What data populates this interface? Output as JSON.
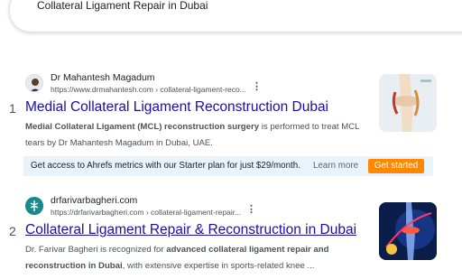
{
  "search": {
    "query": "Collateral Ligament Repair in Dubai"
  },
  "results": [
    {
      "rank": "1",
      "site_name": "Dr Mahantesh Magadum",
      "url": "https://www.drmahantesh.com › collateral-ligament-reco...",
      "title": "Medial Collateral Ligament Reconstruction Dubai",
      "snippet_bold_1": "Medial Collateral Ligament (MCL) reconstruction surgery",
      "snippet_text_1": " is performed to treat MCL tears by Dr Mahantesh Magadum in Dubai, UAE.",
      "favicon_icon": "doctor-portrait-icon",
      "thumb_icon": "knee-ligament-illustration"
    },
    {
      "rank": "2",
      "site_name": "drfarivarbagheri.com",
      "url": "https://drfarivarbagheri.com › collateral-ligament-repair...",
      "title": "Collateral Ligament Repair & Reconstruction in Dubai",
      "snippet_text_0": "Dr. Farivar Bagheri is recognized for ",
      "snippet_bold_1": "advanced collateral ligament repair and reconstruction in Dubai",
      "snippet_text_1": ", with extensive expertise in sports-related knee ...",
      "favicon_icon": "medical-logo-icon",
      "thumb_icon": "knee-xray-illustration"
    }
  ],
  "ahrefs": {
    "message": "Get access to Ahrefs metrics with our Starter plan for just $29/month.",
    "learn_more": "Learn more",
    "cta": "Get started",
    "cta_color": "#ff8800",
    "bar_color": "#e8f3fb"
  },
  "more_icon": "vertical-dots-icon",
  "colors": {
    "link": "#1a0dab",
    "text": "#4d5156"
  }
}
